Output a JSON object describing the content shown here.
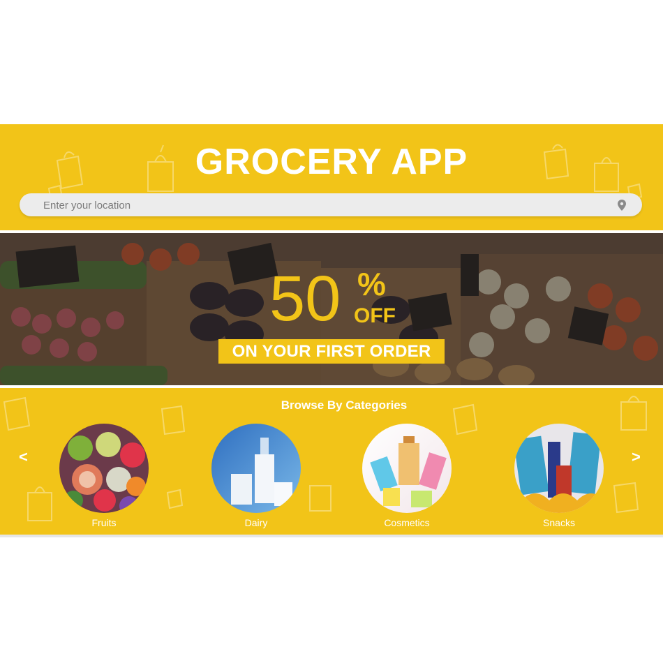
{
  "header": {
    "title": "GROCERY APP",
    "search_placeholder": "Enter your location",
    "search_icon": "location-pin-icon"
  },
  "banner": {
    "discount_number": "50",
    "discount_percent": "%",
    "discount_off": "OFF",
    "tagline": "ON YOUR FIRST ORDER"
  },
  "categories": {
    "title": "Browse By Categories",
    "prev_arrow": "<",
    "next_arrow": ">",
    "items": [
      {
        "label": "Fruits",
        "icon": "fruits-image"
      },
      {
        "label": "Dairy",
        "icon": "dairy-image"
      },
      {
        "label": "Cosmetics",
        "icon": "cosmetics-image"
      },
      {
        "label": "Snacks",
        "icon": "snacks-image"
      }
    ]
  },
  "colors": {
    "brand_yellow": "#f2c418",
    "white": "#ffffff",
    "search_bg": "#ececec"
  }
}
